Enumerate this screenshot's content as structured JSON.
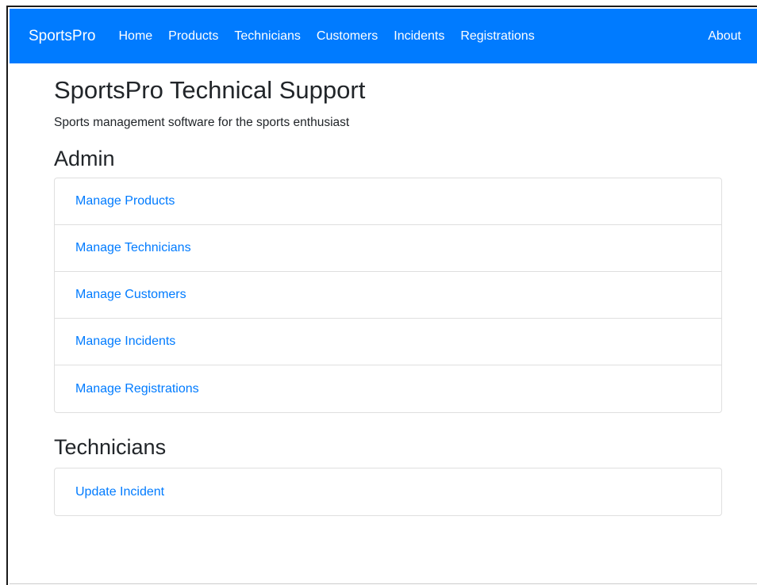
{
  "navbar": {
    "brand": "SportsPro",
    "links": [
      {
        "label": "Home"
      },
      {
        "label": "Products"
      },
      {
        "label": "Technicians"
      },
      {
        "label": "Customers"
      },
      {
        "label": "Incidents"
      },
      {
        "label": "Registrations"
      }
    ],
    "about": "About",
    "background_color": "#007bff"
  },
  "main": {
    "title": "SportsPro Technical Support",
    "tagline": "Sports management software for the sports enthusiast",
    "admin": {
      "heading": "Admin",
      "links": [
        {
          "label": "Manage Products"
        },
        {
          "label": "Manage Technicians"
        },
        {
          "label": "Manage Customers"
        },
        {
          "label": "Manage Incidents"
        },
        {
          "label": "Manage Registrations"
        }
      ]
    },
    "technicians": {
      "heading": "Technicians",
      "links": [
        {
          "label": "Update Incident"
        }
      ]
    },
    "link_color": "#007bff"
  }
}
